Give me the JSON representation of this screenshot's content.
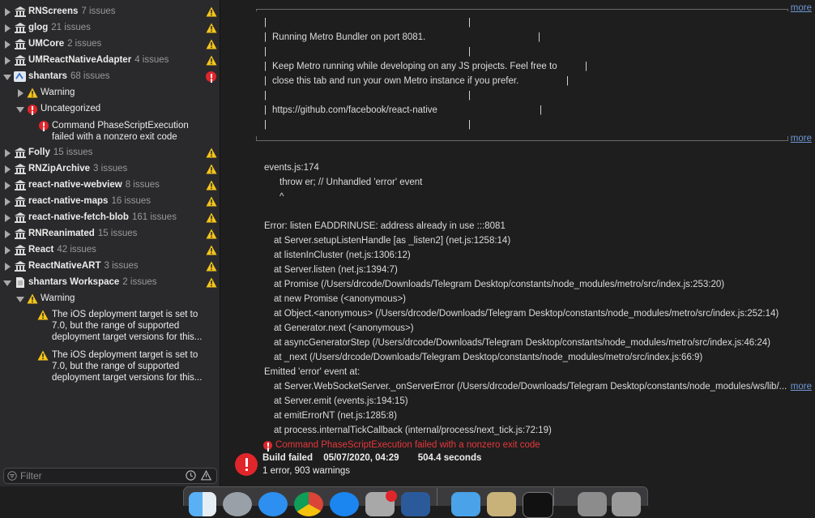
{
  "navigator": {
    "rows": [
      {
        "name": "RNScreens",
        "count": "7 issues",
        "status": "warning"
      },
      {
        "name": "glog",
        "count": "21 issues",
        "status": "warning"
      },
      {
        "name": "UMCore",
        "count": "2 issues",
        "status": "warning"
      },
      {
        "name": "UMReactNativeAdapter",
        "count": "4 issues",
        "status": "warning"
      },
      {
        "name": "shantars",
        "count": "68 issues",
        "status": "error"
      },
      {
        "name": "Warning",
        "count": ""
      },
      {
        "name": "Uncategorized",
        "count": ""
      },
      {
        "name": "Folly",
        "count": "15 issues",
        "status": "warning"
      },
      {
        "name": "RNZipArchive",
        "count": "3 issues",
        "status": "warning"
      },
      {
        "name": "react-native-webview",
        "count": "8 issues",
        "status": "warning"
      },
      {
        "name": "react-native-maps",
        "count": "16 issues",
        "status": "warning"
      },
      {
        "name": "react-native-fetch-blob",
        "count": "161 issues",
        "status": "warning"
      },
      {
        "name": "RNReanimated",
        "count": "15 issues",
        "status": "warning"
      },
      {
        "name": "React",
        "count": "42 issues",
        "status": "warning"
      },
      {
        "name": "ReactNativeART",
        "count": "3 issues",
        "status": "warning"
      },
      {
        "name": "shantars Workspace",
        "count": "2 issues",
        "status": "warning"
      },
      {
        "name": "Warning",
        "count": ""
      }
    ],
    "error_message": [
      "Command PhaseScriptExecution",
      "failed with a nonzero exit code"
    ],
    "warning_message": [
      "The iOS deployment target is set to",
      "7.0, but the range of supported",
      "deployment target versions for this..."
    ],
    "filter_placeholder": "Filter"
  },
  "log": {
    "more_label": "more",
    "metro_box": {
      "line1": "Running Metro Bundler on port 8081.",
      "line2": "Keep Metro running while developing on any JS projects. Feel free to",
      "line3": "close this tab and run your own Metro instance if you prefer.",
      "line4": "https://github.com/facebook/react-native"
    },
    "lines": [
      "events.js:174",
      "throw er; // Unhandled 'error' event",
      "^",
      "Error: listen EADDRINUSE: address already in use :::8081",
      "at Server.setupListenHandle [as _listen2] (net.js:1258:14)",
      "at listenInCluster (net.js:1306:12)",
      "at Server.listen (net.js:1394:7)",
      "at Promise (/Users/drcode/Downloads/Telegram Desktop/constants/node_modules/metro/src/index.js:253:20)",
      "at new Promise (<anonymous>)",
      "at Object.<anonymous> (/Users/drcode/Downloads/Telegram Desktop/constants/node_modules/metro/src/index.js:252:14)",
      "at Generator.next (<anonymous>)",
      "at asyncGeneratorStep (/Users/drcode/Downloads/Telegram Desktop/constants/node_modules/metro/src/index.js:46:24)",
      "at _next (/Users/drcode/Downloads/Telegram Desktop/constants/node_modules/metro/src/index.js:66:9)",
      "Emitted 'error' event at:",
      "at Server.WebSocketServer._onServerError (/Users/drcode/Downloads/Telegram Desktop/constants/node_modules/ws/lib/...",
      "at Server.emit (events.js:194:15)",
      "at emitErrorNT (net.js:1285:8)",
      "at process.internalTickCallback (internal/process/next_tick.js:72:19)"
    ],
    "error_line": "Command PhaseScriptExecution failed with a nonzero exit code",
    "build_status": "Build failed",
    "build_date": "05/07/2020, 04:29",
    "build_duration": "504.4 seconds",
    "summary": "1 error, 903 warnings"
  },
  "colors": {
    "error": "#e0262b",
    "warning": "#f5c518",
    "link": "#6f98d6"
  }
}
